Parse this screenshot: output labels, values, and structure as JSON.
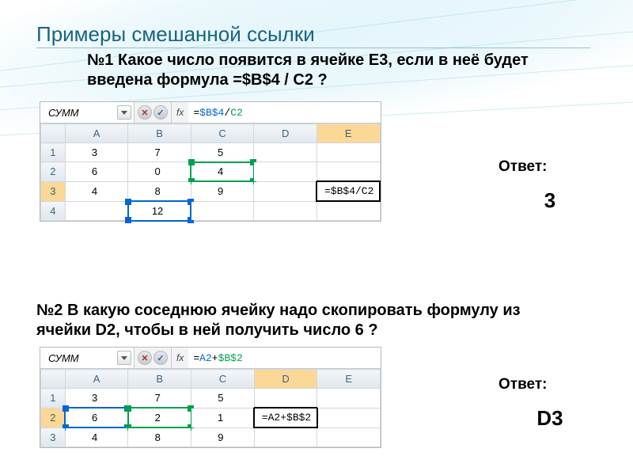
{
  "title": "Примеры смешанной ссылки",
  "q1": "№1 Какое число появится в ячейке E3, если в неё будет введена формула =$B$4 / C2 ?",
  "q2": "№2 В какую соседнюю ячейку надо скопировать формулу из ячейки D2, чтобы в ней получить число 6 ?",
  "answer_label": "Ответ:",
  "answer1": "3",
  "answer2": "D3",
  "excel_common": {
    "name_box": "СУММ",
    "fx_label": "fx",
    "cancel_glyph": "✕",
    "enter_glyph": "✓",
    "columns": [
      "A",
      "B",
      "C",
      "D",
      "E"
    ]
  },
  "sheet1": {
    "formula_bar_parts": {
      "eq": "=",
      "ref1": "$B$4",
      "op": "/",
      "ref2": "C2"
    },
    "cell_formula": "=$B$4/C2",
    "rows": [
      {
        "r": "1",
        "cells": [
          "3",
          "7",
          "5",
          "",
          ""
        ]
      },
      {
        "r": "2",
        "cells": [
          "6",
          "0",
          "4",
          "",
          ""
        ]
      },
      {
        "r": "3",
        "cells": [
          "4",
          "8",
          "9",
          "",
          ""
        ]
      },
      {
        "r": "4",
        "cells": [
          "",
          "12",
          "",
          "",
          ""
        ]
      }
    ],
    "blue_ref_cell": "B4",
    "green_ref_cell": "C2",
    "active_cell": "E3"
  },
  "sheet2": {
    "formula_bar_parts": {
      "eq": "=",
      "ref1": "A2",
      "op": "+",
      "ref2": "$B$2"
    },
    "cell_formula": "=A2+$B$2",
    "rows": [
      {
        "r": "1",
        "cells": [
          "3",
          "7",
          "5",
          "",
          ""
        ]
      },
      {
        "r": "2",
        "cells": [
          "6",
          "2",
          "1",
          "",
          ""
        ]
      },
      {
        "r": "3",
        "cells": [
          "4",
          "8",
          "9",
          "",
          ""
        ]
      }
    ],
    "blue_ref_cell": "A2",
    "green_ref_cell": "B2",
    "active_cell": "D2"
  }
}
